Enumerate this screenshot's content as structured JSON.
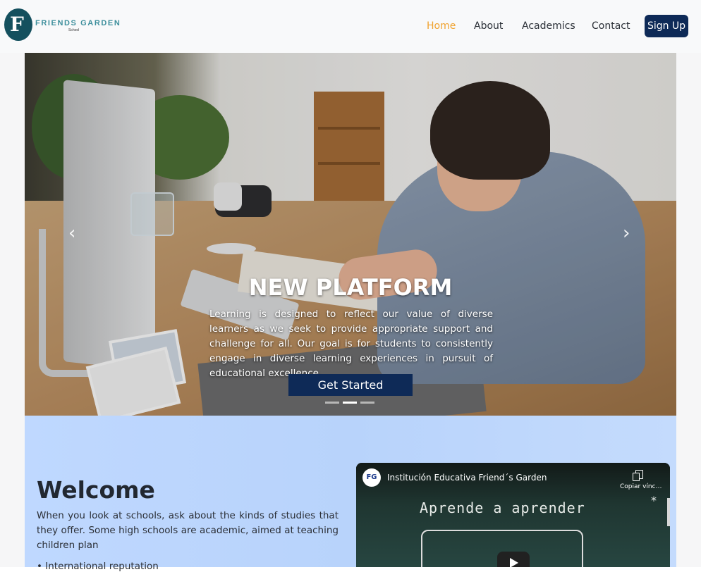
{
  "navbar": {
    "brand_name": "FRIENDS GARDEN",
    "brand_sub": "School",
    "logo_letter": "F",
    "links": [
      "Home",
      "About",
      "Academics",
      "Contact"
    ],
    "active_link": "Home",
    "signup_label": "Sign Up"
  },
  "hero": {
    "title": "NEW PLATFORM",
    "text": "Learning is designed to reflect our value of diverse learners as we seek to provide appropriate support and challenge for all. Our goal is for students to consistently engage in diverse learning experiences in pursuit of educational excellence.",
    "cta_label": "Get Started",
    "prev_icon": "chevron-left-icon",
    "next_icon": "chevron-right-icon",
    "slides_total": 3,
    "active_slide": 2
  },
  "welcome": {
    "title": "Welcome",
    "text": "When you look at schools, ask about the kinds of studies that they offer. Some high schools are academic, aimed at teaching children plan",
    "bullet": "International reputation"
  },
  "video": {
    "channel_logo": "FG",
    "title": "Institución Educativa Friend´s Garden",
    "copy_label": "Copiar vínc…",
    "chalk_text": "Aprende a aprender"
  },
  "colors": {
    "accent_active": "#f0a32f",
    "button_navy": "#0e2a57",
    "welcome_bg": "#bfd8ff",
    "logo_teal": "#14505e"
  }
}
